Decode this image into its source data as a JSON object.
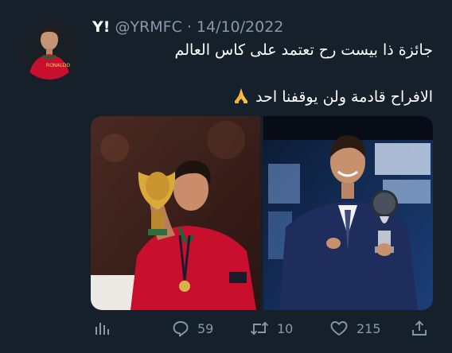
{
  "tweet": {
    "display_name": "Y!",
    "handle": "@YRMFC",
    "separator": "·",
    "date": "14/10/2022",
    "avatar_jersey_text": "RONALDO",
    "text_line1": "جائزة ذا بيست رح تعتمد على كاس العالم",
    "text_line2": "الافراح قادمة ولن يوقفنا احد",
    "emoji": "folded-hands-icon"
  },
  "actions": {
    "analytics_icon": "analytics-icon",
    "reply_count": "59",
    "retweet_count": "10",
    "like_count": "215",
    "share_icon": "share-icon"
  },
  "colors": {
    "background": "#15202b",
    "text_primary": "#ffffff",
    "text_secondary": "#8899a6",
    "jersey_red": "#c8102e",
    "suit_navy": "#1f2d5c"
  }
}
